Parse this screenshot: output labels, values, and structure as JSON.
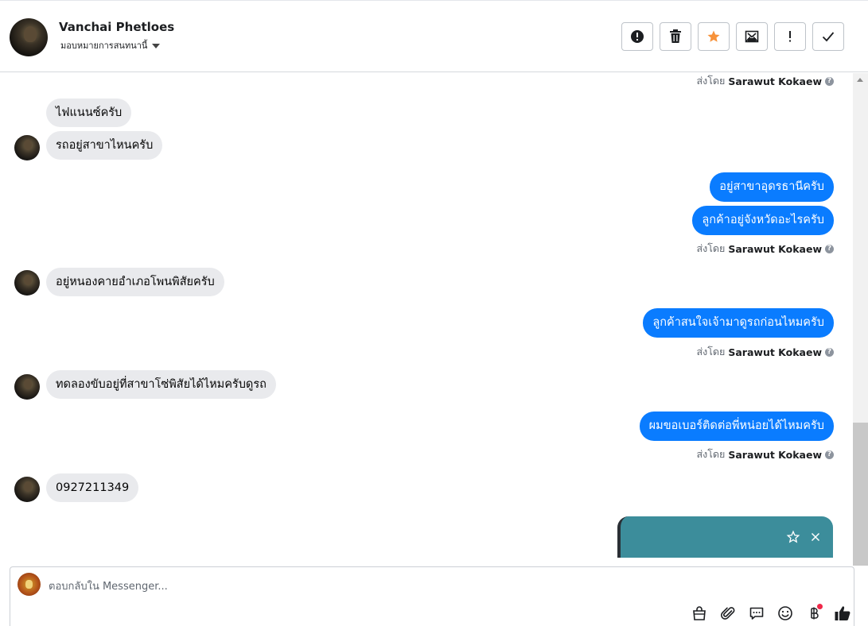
{
  "header": {
    "contact_name": "Vanchai Phetloes",
    "assign_label": "มอบหมายการสนทนานี้"
  },
  "toolbar": {
    "buttons": [
      {
        "name": "report-spam",
        "icon": "alert-circle-icon"
      },
      {
        "name": "delete",
        "icon": "trash-icon"
      },
      {
        "name": "star",
        "icon": "star-icon",
        "color": "#f7923a"
      },
      {
        "name": "mark-unread",
        "icon": "envelope-icon"
      },
      {
        "name": "follow-up",
        "icon": "exclamation-icon"
      },
      {
        "name": "done",
        "icon": "checkmark-icon"
      }
    ]
  },
  "messages": {
    "sent_prefix": "ส่งโดย",
    "agent_name": "Sarawut Kokaew",
    "help_glyph": "?",
    "items": [
      {
        "side": "in",
        "text": "ไฟแนนซ์ครับ"
      },
      {
        "side": "in",
        "text": "รถอยู่สาขาไหนครับ"
      },
      {
        "side": "out",
        "text": "อยู่สาขาอุดรธานีครับ"
      },
      {
        "side": "out",
        "text": "ลูกค้าอยู่จังหวัดอะไรครับ"
      },
      {
        "side": "in",
        "text": "อยู่หนองคายอำเภอโพนพิสัยครับ"
      },
      {
        "side": "out",
        "text": "ลูกค้าสนใจเจ้ามาดูรถก่อนไหมครับ"
      },
      {
        "side": "in",
        "text": "ทดลองขับอยู่ที่สาขาโซ่พิสัยได้ไหมครับดูรถ"
      },
      {
        "side": "out",
        "text": "ผมขอเบอร์ติดต่อพี่หน่อยได้ไหมครับ"
      },
      {
        "side": "in",
        "text": "0927211349"
      }
    ]
  },
  "card": {
    "icons": [
      "star-outline-icon",
      "close-icon"
    ],
    "color": "#3c8d9b"
  },
  "composer": {
    "placeholder": "ตอบกลับใน Messenger...",
    "tools": [
      "shopping-bag-icon",
      "paperclip-icon",
      "saved-reply-icon",
      "emoji-icon",
      "baht-payment-icon",
      "thumbs-up-icon"
    ]
  },
  "colors": {
    "outgoing_bubble": "#0a7cff",
    "incoming_bubble": "#e9eaed",
    "accent": "#1877f2"
  }
}
